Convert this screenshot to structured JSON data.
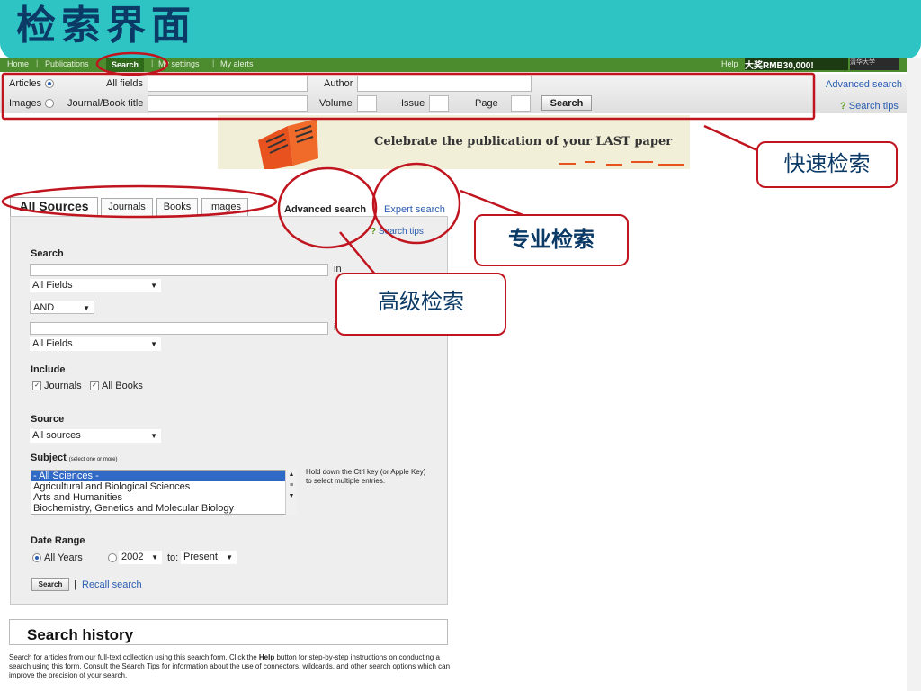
{
  "slide_title": "检索界面",
  "nav": {
    "items": [
      "Home",
      "Publications",
      "Search",
      "My settings",
      "My alerts"
    ],
    "help": "Help",
    "promo": "大奖RMB30,000!",
    "logo_text": "清华大学"
  },
  "quick": {
    "articles_label": "Articles",
    "images_label": "Images",
    "all_fields_label": "All fields",
    "journal_title_label": "Journal/Book title",
    "author_label": "Author",
    "volume_label": "Volume",
    "issue_label": "Issue",
    "page_label": "Page",
    "search_button": "Search",
    "advanced_link": "Advanced search",
    "tips_link": "Search tips"
  },
  "banner": {
    "text": "Celebrate the publication of your LAST paper"
  },
  "tabs": {
    "items": [
      "All Sources",
      "Journals",
      "Books",
      "Images"
    ],
    "advanced": "Advanced search",
    "expert": "Expert search"
  },
  "form": {
    "tips": "Search tips",
    "search_label": "Search",
    "in_label": "in",
    "field1": "All Fields",
    "operator": "AND",
    "field2": "All Fields",
    "include_label": "Include",
    "journals": "Journals",
    "all_books": "All Books",
    "source_label": "Source",
    "source_value": "All sources",
    "subject_label": "Subject",
    "subject_hint": "(select one or more)",
    "subjects": [
      "- All Sciences -",
      "Agricultural and Biological Sciences",
      "Arts and Humanities",
      "Biochemistry, Genetics and Molecular Biology"
    ],
    "ctrl_hint": "Hold down the Ctrl key (or Apple Key) to select multiple entries.",
    "date_label": "Date Range",
    "all_years": "All Years",
    "year_from": "2002",
    "to_label": "to:",
    "year_to": "Present",
    "search_button": "Search",
    "recall_link": "Recall search"
  },
  "history": {
    "title": "Search history",
    "desc_before": "Search for articles from our full-text collection using this search form. Click the ",
    "desc_bold": "Help",
    "desc_after": " button for step-by-step instructions on conducting a search using this form. Consult the Search Tips for information about the use of connectors, wildcards, and other search options which can improve the precision of your search."
  },
  "callouts": {
    "quick": "快速检索",
    "expert": "专业检索",
    "advanced": "高级检索"
  },
  "colors": {
    "teal": "#2ec4c4",
    "nav_green": "#4d8b2f",
    "annotation_red": "#c0141f",
    "title_blue": "#0b3a66"
  }
}
